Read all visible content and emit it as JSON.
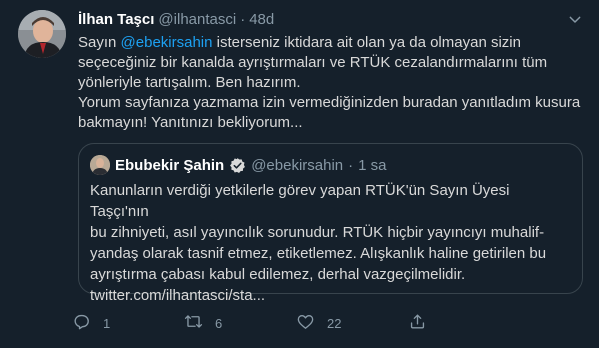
{
  "author": {
    "name": "İlhan Taşcı",
    "handle": "@ilhantasci",
    "separator": "·",
    "time": "48d"
  },
  "tweet": {
    "prefix": "Sayın ",
    "mention": "@ebekirsahin",
    "line1_rest": " isterseniz iktidara ait olan ya da olmayan sizin",
    "line2": "seçeceğiniz bir kanalda ayrıştırmaları ve RTÜK cezalandırmalarını tüm",
    "line3": "yönleriyle tartışalım. Ben hazırım.",
    "line4": "Yorum sayfanıza yazmama izin vermediğinizden buradan yanıtladım kusura",
    "line5": "bakmayın! Yanıtınızı bekliyorum..."
  },
  "quote": {
    "name": "Ebubekir Şahin",
    "handle": "@ebekirsahin",
    "separator": "·",
    "time": "1 sa",
    "lines": [
      "Kanunların verdiği yetkilerle görev yapan RTÜK'ün Sayın Üyesi Taşçı'nın",
      "bu zihniyeti, asıl yayıncılık sorunudur. RTÜK hiçbir yayıncıyı muhalif-",
      "yandaş olarak tasnif etmez, etiketlemez. Alışkanlık haline getirilen bu",
      "ayrıştırma çabası kabul edilemez, derhal vazgeçilmelidir.",
      "twitter.com/ilhantasci/sta..."
    ]
  },
  "actions": {
    "reply_count": "1",
    "retweet_count": "6",
    "like_count": "22",
    "share_count": ""
  },
  "icons": {
    "reply": "reply-icon",
    "retweet": "retweet-icon",
    "like": "heart-icon",
    "share": "share-icon",
    "more": "chevron-down-icon",
    "verified": "verified-badge-icon"
  },
  "colors": {
    "background": "#15202b",
    "text": "#d9d9d9",
    "secondary": "#8899a6",
    "accent": "#1da1f2",
    "border": "#38444d"
  }
}
